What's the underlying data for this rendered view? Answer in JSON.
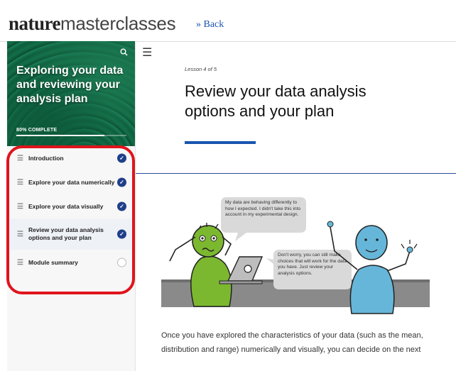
{
  "header": {
    "brand_bold": "nature",
    "brand_light": "masterclasses",
    "back_label": "» Back"
  },
  "sidebar": {
    "course_title": "Exploring your data and reviewing your analysis plan",
    "progress_label": "80% COMPLETE",
    "progress": 0.8,
    "items": [
      {
        "label": "Introduction",
        "done": true
      },
      {
        "label": "Explore your data numerically",
        "done": true
      },
      {
        "label": "Explore your data visually",
        "done": true
      },
      {
        "label": "Review your data analysis options and your plan",
        "done": true,
        "active": true
      },
      {
        "label": "Module summary",
        "done": false
      }
    ]
  },
  "lesson": {
    "number_label": "Lesson 4 of 5",
    "title": "Review your data analysis options and your plan",
    "bubble_left": "My data are behaving differently to how I expected. I didn't take this into account in my experimental design.",
    "bubble_right": "Don't worry, you can still make choices that will work for the data you have. Just review your analysis options.",
    "body": "Once you have explored the characteristics of your data (such as the mean, distribution and range) numerically and visually, you can decide on the next"
  },
  "colors": {
    "accent": "#1a55b0",
    "check": "#1f3f8a",
    "highlight_ring": "#e0141c"
  }
}
